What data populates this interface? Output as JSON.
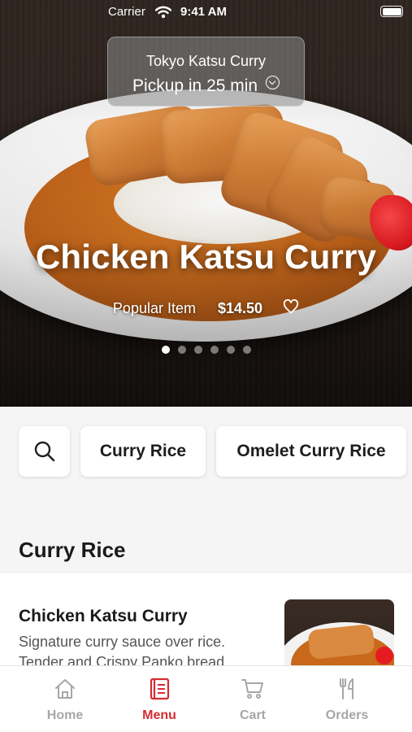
{
  "status_bar": {
    "carrier": "Carrier",
    "time": "9:41 AM"
  },
  "pickup": {
    "store_name": "Tokyo Katsu Curry",
    "eta": "Pickup in 25 min"
  },
  "hero": {
    "title": "Chicken Katsu Curry",
    "tag": "Popular Item",
    "price": "$14.50",
    "carousel_total": 6,
    "carousel_active": 1
  },
  "categories": [
    "Curry Rice",
    "Omelet Curry Rice"
  ],
  "section": {
    "title": "Curry Rice"
  },
  "items": [
    {
      "name": "Chicken Katsu Curry",
      "description": "Signature curry sauce over rice. Tender and Crispy Panko bread..."
    }
  ],
  "tabs": [
    {
      "label": "Home",
      "icon": "home-icon"
    },
    {
      "label": "Menu",
      "icon": "menu-book-icon"
    },
    {
      "label": "Cart",
      "icon": "cart-icon"
    },
    {
      "label": "Orders",
      "icon": "fork-knife-icon"
    }
  ],
  "colors": {
    "accent": "#d62b33",
    "inactive": "#a7a7a7"
  }
}
